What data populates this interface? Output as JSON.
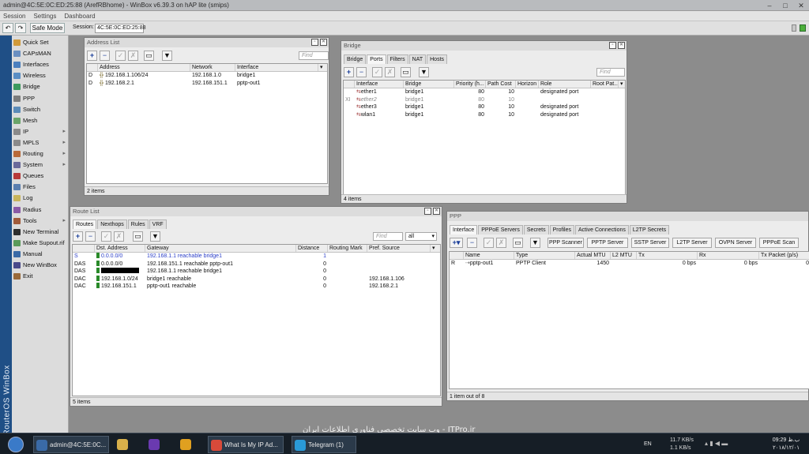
{
  "titlebar": {
    "title": "admin@4C:5E:0C:ED:25:88 (ArefRBhome) - WinBox v6.39.3 on hAP lite (smips)"
  },
  "menubar": [
    "Session",
    "Settings",
    "Dashboard"
  ],
  "toolbar": {
    "safe_mode": "Safe Mode",
    "session_label": "Session:",
    "session_value": "4C:5E:0C:ED:25:88"
  },
  "brand": "RouterOS WinBox",
  "sidebar": [
    {
      "label": "Quick Set",
      "icon": "quick-set-icon",
      "color": "#d09a3a",
      "arrow": ""
    },
    {
      "label": "CAPsMAN",
      "icon": "capsman-icon",
      "color": "#6a8fc1",
      "arrow": ""
    },
    {
      "label": "Interfaces",
      "icon": "interfaces-icon",
      "color": "#4a7fbf",
      "arrow": ""
    },
    {
      "label": "Wireless",
      "icon": "wireless-icon",
      "color": "#5a8ec4",
      "arrow": ""
    },
    {
      "label": "Bridge",
      "icon": "bridge-icon",
      "color": "#3c9a5e",
      "arrow": ""
    },
    {
      "label": "PPP",
      "icon": "ppp-icon",
      "color": "#7d7d7d",
      "arrow": ""
    },
    {
      "label": "Switch",
      "icon": "switch-icon",
      "color": "#5b8bb8",
      "arrow": ""
    },
    {
      "label": "Mesh",
      "icon": "mesh-icon",
      "color": "#6aa46a",
      "arrow": ""
    },
    {
      "label": "IP",
      "icon": "ip-icon",
      "color": "#8a8a8a",
      "arrow": "▸"
    },
    {
      "label": "MPLS",
      "icon": "mpls-icon",
      "color": "#8a8a8a",
      "arrow": "▸"
    },
    {
      "label": "Routing",
      "icon": "routing-icon",
      "color": "#b86a3a",
      "arrow": "▸"
    },
    {
      "label": "System",
      "icon": "system-icon",
      "color": "#6a6a9a",
      "arrow": "▸"
    },
    {
      "label": "Queues",
      "icon": "queues-icon",
      "color": "#b73a3a",
      "arrow": ""
    },
    {
      "label": "Files",
      "icon": "files-icon",
      "color": "#5a7fb0",
      "arrow": ""
    },
    {
      "label": "Log",
      "icon": "log-icon",
      "color": "#c8b45a",
      "arrow": ""
    },
    {
      "label": "Radius",
      "icon": "radius-icon",
      "color": "#8a5aa6",
      "arrow": ""
    },
    {
      "label": "Tools",
      "icon": "tools-icon",
      "color": "#a05a3a",
      "arrow": "▸"
    },
    {
      "label": "New Terminal",
      "icon": "terminal-icon",
      "color": "#2e2e2e",
      "arrow": ""
    },
    {
      "label": "Make Supout.rif",
      "icon": "supout-icon",
      "color": "#5a9a5a",
      "arrow": ""
    },
    {
      "label": "Manual",
      "icon": "manual-icon",
      "color": "#3a6aa6",
      "arrow": ""
    },
    {
      "label": "New WinBox",
      "icon": "winbox-icon",
      "color": "#4a4a8a",
      "arrow": ""
    },
    {
      "label": "Exit",
      "icon": "exit-icon",
      "color": "#9a6a3a",
      "arrow": ""
    }
  ],
  "address_list": {
    "title": "Address List",
    "find": "Find",
    "columns": [
      "Address",
      "Network",
      "Interface"
    ],
    "rows": [
      {
        "flag": "D",
        "address": "192.168.1.106/24",
        "network": "192.168.1.0",
        "interface": "bridge1"
      },
      {
        "flag": "D",
        "address": "192.168.2.1",
        "network": "192.168.151.1",
        "interface": "pptp-out1"
      }
    ],
    "status": "2 items"
  },
  "bridge": {
    "title": "Bridge",
    "tabs": [
      "Bridge",
      "Ports",
      "Filters",
      "NAT",
      "Hosts"
    ],
    "active_tab": "Ports",
    "find": "Find",
    "columns": [
      "Interface",
      "Bridge",
      "Priority (h...",
      "Path Cost",
      "Horizon",
      "Role",
      "Root Pat..."
    ],
    "rows": [
      {
        "flag": "",
        "interface": "ether1",
        "bridge": "bridge1",
        "priority": "80",
        "path_cost": "10",
        "horizon": "",
        "role": "designated port"
      },
      {
        "flag": "XI",
        "interface": "ether2",
        "bridge": "bridge1",
        "priority": "80",
        "path_cost": "10",
        "horizon": "",
        "role": ""
      },
      {
        "flag": "",
        "interface": "ether3",
        "bridge": "bridge1",
        "priority": "80",
        "path_cost": "10",
        "horizon": "",
        "role": "designated port"
      },
      {
        "flag": "",
        "interface": "wlan1",
        "bridge": "bridge1",
        "priority": "80",
        "path_cost": "10",
        "horizon": "",
        "role": "designated port"
      }
    ],
    "status": "4 items"
  },
  "route_list": {
    "title": "Route List",
    "tabs": [
      "Routes",
      "Nexthops",
      "Rules",
      "VRF"
    ],
    "active_tab": "Routes",
    "find": "Find",
    "filter": "all",
    "columns": [
      "Dst. Address",
      "Gateway",
      "Distance",
      "Routing Mark",
      "Pref. Source"
    ],
    "rows": [
      {
        "flag": "S",
        "dst": "0.0.0.0/0",
        "gateway": "192.168.1.1 reachable bridge1",
        "distance": "1",
        "mark": "",
        "pref": "",
        "blue": true
      },
      {
        "flag": "DAS",
        "dst": "0.0.0.0/0",
        "gateway": "192.168.151.1 reachable pptp-out1",
        "distance": "0",
        "mark": "",
        "pref": "",
        "blue": false
      },
      {
        "flag": "DAS",
        "dst": "",
        "gateway": "192.168.1.1 reachable bridge1",
        "distance": "0",
        "mark": "",
        "pref": "",
        "blue": false,
        "redacted": true
      },
      {
        "flag": "DAC",
        "dst": "192.168.1.0/24",
        "gateway": "bridge1 reachable",
        "distance": "0",
        "mark": "",
        "pref": "192.168.1.106",
        "blue": false
      },
      {
        "flag": "DAC",
        "dst": "192.168.151.1",
        "gateway": "pptp-out1 reachable",
        "distance": "0",
        "mark": "",
        "pref": "192.168.2.1",
        "blue": false
      }
    ],
    "status": "5 items"
  },
  "ppp": {
    "title": "PPP",
    "tabs": [
      "Interface",
      "PPPoE Servers",
      "Secrets",
      "Profiles",
      "Active Connections",
      "L2TP Secrets"
    ],
    "active_tab": "Interface",
    "buttons": [
      "PPP Scanner",
      "PPTP Server",
      "SSTP Server",
      "L2TP Server",
      "OVPN Server",
      "PPPoE Scan"
    ],
    "columns": [
      "Name",
      "Type",
      "Actual MTU",
      "L2 MTU",
      "Tx",
      "Rx",
      "Tx Packet (p/s)"
    ],
    "rows": [
      {
        "flag": "R",
        "name": "pptp-out1",
        "type": "PPTP Client",
        "actual_mtu": "1450",
        "l2_mtu": "",
        "tx": "0 bps",
        "rx": "0 bps",
        "tx_packet": "0"
      }
    ],
    "status": "1 item out of 8"
  },
  "watermark": "وب سایت تخصصی فناوری اطلاعات ایران - ITPro.ir",
  "taskbar": {
    "items": [
      {
        "label": "admin@4C:5E:0C...",
        "icon": "winbox-app-icon",
        "color": "#3a6aa6"
      },
      {
        "label": "",
        "icon": "folder-icon",
        "color": "#d8b04a"
      },
      {
        "label": "",
        "icon": "visual-studio-icon",
        "color": "#6a3ab0"
      },
      {
        "label": "",
        "icon": "archicad-icon",
        "color": "#e0a020"
      },
      {
        "label": "What Is My IP Ad...",
        "icon": "chrome-icon",
        "color": "#d84a3a"
      },
      {
        "label": "Telegram (1)",
        "icon": "telegram-icon",
        "color": "#2a9ad8"
      }
    ],
    "lang": "EN",
    "net_up": "11.7 KB/s",
    "net_down": "1.1 KB/s",
    "time": "09:29 ب.ظ",
    "date": "۲۰۱۸/۱۲/۰۱"
  }
}
